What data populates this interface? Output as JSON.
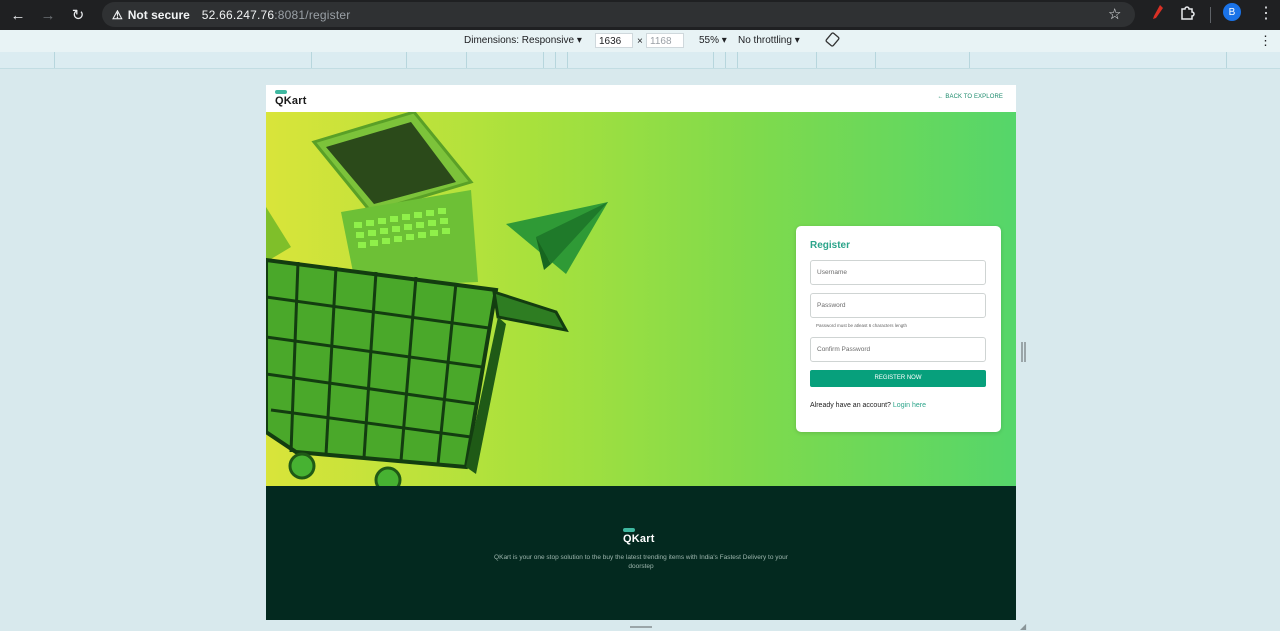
{
  "browser": {
    "security_label": "Not secure",
    "url_host": "52.66.247.76",
    "url_path": ":8081/register",
    "profile_initial": "B"
  },
  "devtools": {
    "dimensions_label": "Dimensions: Responsive ▾",
    "width": "1636",
    "times": "×",
    "height": "1168",
    "zoom": "55% ▾",
    "throttling": "No throttling ▾"
  },
  "app": {
    "logo_text": "QKart",
    "back_link": "← BACK TO EXPLORE"
  },
  "register": {
    "title": "Register",
    "username_placeholder": "Username",
    "password_placeholder": "Password",
    "password_hint": "Password must be atleast 6 characters length",
    "confirm_placeholder": "Confirm Password",
    "button_label": "REGISTER NOW",
    "already_text": "Already have an account?",
    "login_link": "Login here"
  },
  "footer": {
    "logo_text": "QKart",
    "description": "QKart is your one stop solution to the buy the latest trending items with India's Fastest Delivery to your doorstep"
  },
  "colors": {
    "brand": "#2ba48a",
    "button": "#07a07c",
    "footer_bg": "#03291f"
  }
}
